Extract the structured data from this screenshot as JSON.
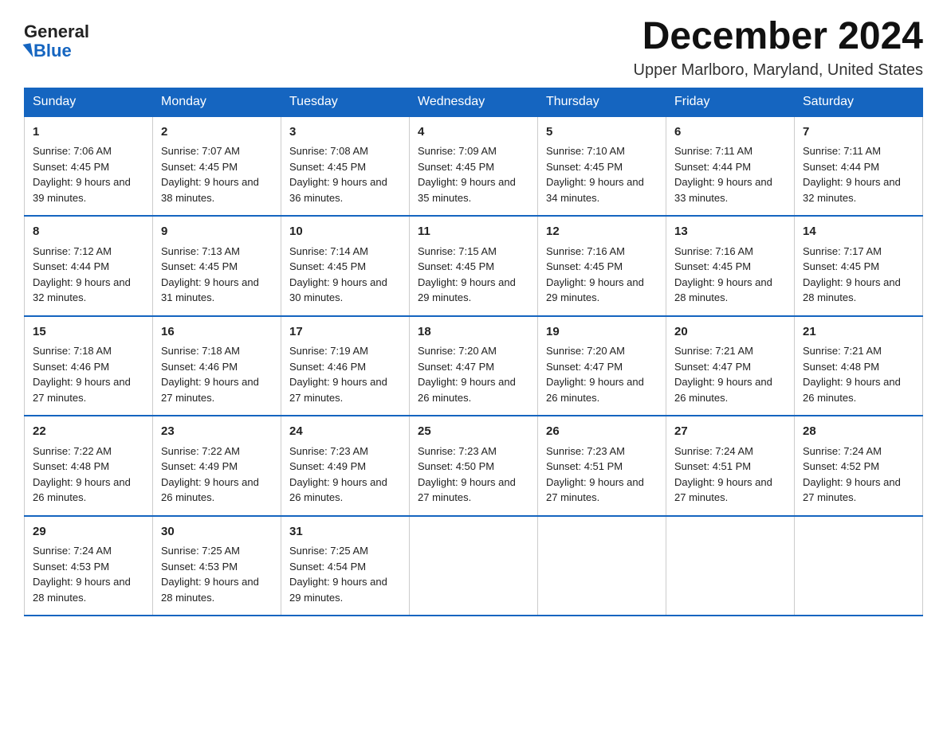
{
  "logo": {
    "general": "General",
    "blue": "Blue"
  },
  "title": "December 2024",
  "location": "Upper Marlboro, Maryland, United States",
  "days_of_week": [
    "Sunday",
    "Monday",
    "Tuesday",
    "Wednesday",
    "Thursday",
    "Friday",
    "Saturday"
  ],
  "weeks": [
    [
      {
        "day": "1",
        "sunrise": "7:06 AM",
        "sunset": "4:45 PM",
        "daylight": "9 hours and 39 minutes."
      },
      {
        "day": "2",
        "sunrise": "7:07 AM",
        "sunset": "4:45 PM",
        "daylight": "9 hours and 38 minutes."
      },
      {
        "day": "3",
        "sunrise": "7:08 AM",
        "sunset": "4:45 PM",
        "daylight": "9 hours and 36 minutes."
      },
      {
        "day": "4",
        "sunrise": "7:09 AM",
        "sunset": "4:45 PM",
        "daylight": "9 hours and 35 minutes."
      },
      {
        "day": "5",
        "sunrise": "7:10 AM",
        "sunset": "4:45 PM",
        "daylight": "9 hours and 34 minutes."
      },
      {
        "day": "6",
        "sunrise": "7:11 AM",
        "sunset": "4:44 PM",
        "daylight": "9 hours and 33 minutes."
      },
      {
        "day": "7",
        "sunrise": "7:11 AM",
        "sunset": "4:44 PM",
        "daylight": "9 hours and 32 minutes."
      }
    ],
    [
      {
        "day": "8",
        "sunrise": "7:12 AM",
        "sunset": "4:44 PM",
        "daylight": "9 hours and 32 minutes."
      },
      {
        "day": "9",
        "sunrise": "7:13 AM",
        "sunset": "4:45 PM",
        "daylight": "9 hours and 31 minutes."
      },
      {
        "day": "10",
        "sunrise": "7:14 AM",
        "sunset": "4:45 PM",
        "daylight": "9 hours and 30 minutes."
      },
      {
        "day": "11",
        "sunrise": "7:15 AM",
        "sunset": "4:45 PM",
        "daylight": "9 hours and 29 minutes."
      },
      {
        "day": "12",
        "sunrise": "7:16 AM",
        "sunset": "4:45 PM",
        "daylight": "9 hours and 29 minutes."
      },
      {
        "day": "13",
        "sunrise": "7:16 AM",
        "sunset": "4:45 PM",
        "daylight": "9 hours and 28 minutes."
      },
      {
        "day": "14",
        "sunrise": "7:17 AM",
        "sunset": "4:45 PM",
        "daylight": "9 hours and 28 minutes."
      }
    ],
    [
      {
        "day": "15",
        "sunrise": "7:18 AM",
        "sunset": "4:46 PM",
        "daylight": "9 hours and 27 minutes."
      },
      {
        "day": "16",
        "sunrise": "7:18 AM",
        "sunset": "4:46 PM",
        "daylight": "9 hours and 27 minutes."
      },
      {
        "day": "17",
        "sunrise": "7:19 AM",
        "sunset": "4:46 PM",
        "daylight": "9 hours and 27 minutes."
      },
      {
        "day": "18",
        "sunrise": "7:20 AM",
        "sunset": "4:47 PM",
        "daylight": "9 hours and 26 minutes."
      },
      {
        "day": "19",
        "sunrise": "7:20 AM",
        "sunset": "4:47 PM",
        "daylight": "9 hours and 26 minutes."
      },
      {
        "day": "20",
        "sunrise": "7:21 AM",
        "sunset": "4:47 PM",
        "daylight": "9 hours and 26 minutes."
      },
      {
        "day": "21",
        "sunrise": "7:21 AM",
        "sunset": "4:48 PM",
        "daylight": "9 hours and 26 minutes."
      }
    ],
    [
      {
        "day": "22",
        "sunrise": "7:22 AM",
        "sunset": "4:48 PM",
        "daylight": "9 hours and 26 minutes."
      },
      {
        "day": "23",
        "sunrise": "7:22 AM",
        "sunset": "4:49 PM",
        "daylight": "9 hours and 26 minutes."
      },
      {
        "day": "24",
        "sunrise": "7:23 AM",
        "sunset": "4:49 PM",
        "daylight": "9 hours and 26 minutes."
      },
      {
        "day": "25",
        "sunrise": "7:23 AM",
        "sunset": "4:50 PM",
        "daylight": "9 hours and 27 minutes."
      },
      {
        "day": "26",
        "sunrise": "7:23 AM",
        "sunset": "4:51 PM",
        "daylight": "9 hours and 27 minutes."
      },
      {
        "day": "27",
        "sunrise": "7:24 AM",
        "sunset": "4:51 PM",
        "daylight": "9 hours and 27 minutes."
      },
      {
        "day": "28",
        "sunrise": "7:24 AM",
        "sunset": "4:52 PM",
        "daylight": "9 hours and 27 minutes."
      }
    ],
    [
      {
        "day": "29",
        "sunrise": "7:24 AM",
        "sunset": "4:53 PM",
        "daylight": "9 hours and 28 minutes."
      },
      {
        "day": "30",
        "sunrise": "7:25 AM",
        "sunset": "4:53 PM",
        "daylight": "9 hours and 28 minutes."
      },
      {
        "day": "31",
        "sunrise": "7:25 AM",
        "sunset": "4:54 PM",
        "daylight": "9 hours and 29 minutes."
      },
      null,
      null,
      null,
      null
    ]
  ],
  "cell_labels": {
    "sunrise": "Sunrise: ",
    "sunset": "Sunset: ",
    "daylight": "Daylight: "
  }
}
